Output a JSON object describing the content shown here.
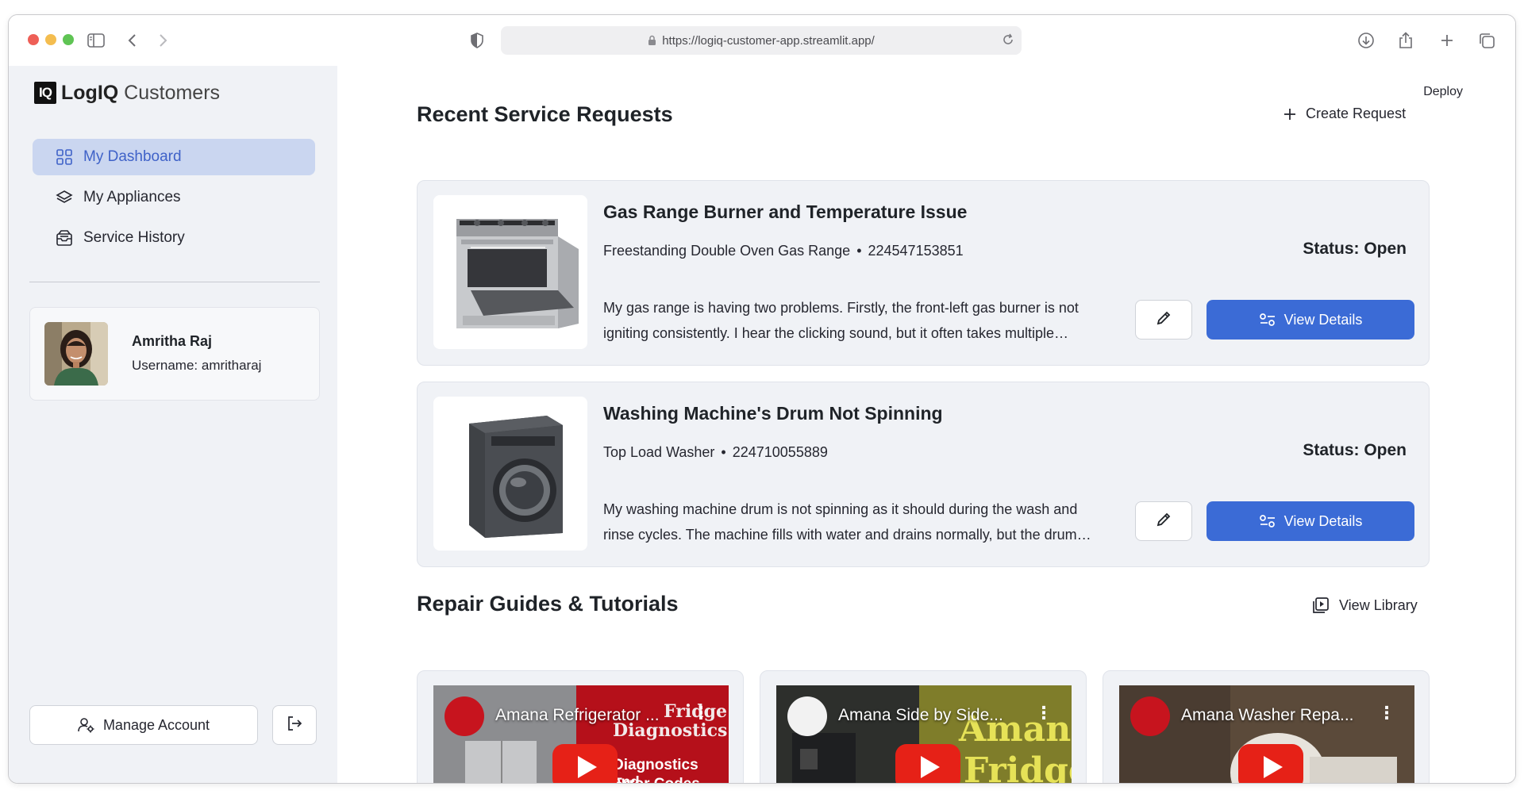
{
  "browser": {
    "url": "https://logiq-customer-app.streamlit.app/"
  },
  "app": {
    "logo_mark": "IQ",
    "brand_bold": "LogIQ",
    "brand_light": "Customers",
    "deploy_label": "Deploy"
  },
  "sidebar": {
    "items": [
      {
        "label": "My Dashboard",
        "icon": "grid-icon",
        "active": true
      },
      {
        "label": "My Appliances",
        "icon": "layers-icon",
        "active": false
      },
      {
        "label": "Service History",
        "icon": "inbox-icon",
        "active": false
      }
    ],
    "profile": {
      "name": "Amritha Raj",
      "username": "Username: amritharaj"
    },
    "manage_account_label": "Manage Account"
  },
  "service_requests": {
    "title": "Recent Service Requests",
    "create_label": "Create Request",
    "items": [
      {
        "title": "Gas Range Burner and Temperature Issue",
        "appliance": "Freestanding Double Oven Gas Range",
        "serial": "224547153851",
        "description": "My gas range is having two problems. Firstly, the front-left gas burner is not igniting consistently. I hear the clicking sound, but it often takes multiple attempts to light.",
        "status": "Status: Open",
        "view_label": "View Details"
      },
      {
        "title": "Washing Machine's Drum Not Spinning",
        "appliance": "Top Load Washer",
        "serial": "224710055889",
        "description": "My washing machine drum is not spinning as it should during the wash and rinse cycles. The machine fills with water and drains normally, but the drum does not spin.",
        "status": "Status: Open",
        "view_label": "View Details"
      }
    ]
  },
  "guides": {
    "title": "Repair Guides & Tutorials",
    "library_label": "View Library",
    "videos": [
      {
        "title": "Amana Refrigerator ...",
        "overlay_top": "Fridge",
        "overlay_mid": "Diagnostics",
        "overlay_bottom_1": "Diagnostics and",
        "overlay_bottom_2": "Error Codes"
      },
      {
        "title": "Amana Side by Side...",
        "overlay_top": "Amana",
        "overlay_mid": "Fridge"
      },
      {
        "title": "Amana Washer Repa..."
      }
    ]
  },
  "colors": {
    "accent": "#3b6bd6",
    "active_nav_bg": "#cad6f0",
    "active_nav_text": "#3f62c8",
    "sidebar_bg": "#f0f2f6",
    "youtube_red": "#e62117"
  }
}
